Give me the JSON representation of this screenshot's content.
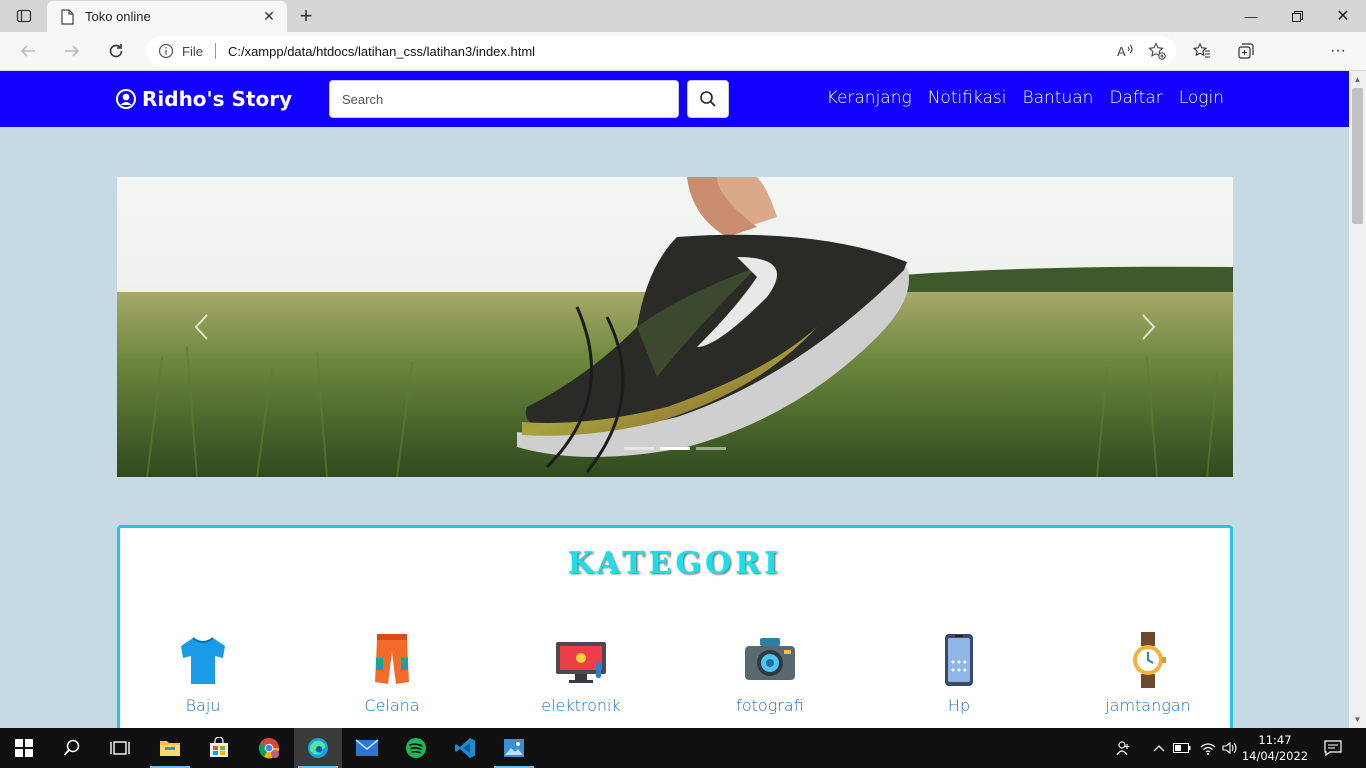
{
  "browser": {
    "tab_title": "Toko online",
    "url_prefix": "File",
    "url": "C:/xampp/data/htdocs/latihan_css/latihan3/index.html"
  },
  "site": {
    "brand": "Ridho's Story",
    "search_placeholder": "Search",
    "nav_links": [
      "Keranjang",
      "Notifikasi",
      "Bantuan",
      "Daftar",
      "Login"
    ],
    "brand_color": "#1100ff"
  },
  "carousel": {
    "slide_count": 3,
    "active_index": 1,
    "image_subject": "sneakers-in-grass-field"
  },
  "kategori": {
    "title": "KATEGORI",
    "items": [
      {
        "label": "Baju",
        "icon": "tshirt-icon"
      },
      {
        "label": "Celana",
        "icon": "pants-icon"
      },
      {
        "label": "elektronik",
        "icon": "monitor-icon"
      },
      {
        "label": "fotografi",
        "icon": "camera-icon"
      },
      {
        "label": "Hp",
        "icon": "phone-icon"
      },
      {
        "label": "jamtangan",
        "icon": "watch-icon"
      }
    ]
  },
  "taskbar": {
    "time": "11:47",
    "date": "14/04/2022"
  }
}
